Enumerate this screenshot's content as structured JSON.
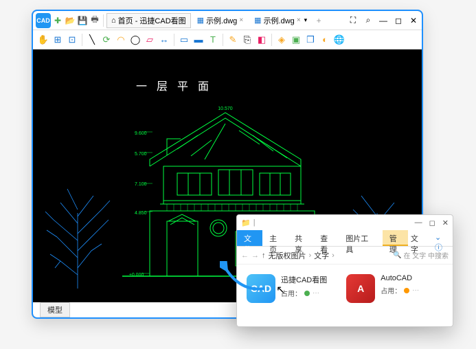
{
  "app": {
    "logo_text": "CAD"
  },
  "tabs": [
    {
      "icon": "⌂",
      "label": "首页 - 迅捷CAD看图"
    },
    {
      "icon": "▦",
      "label": "示例.dwg"
    },
    {
      "icon": "▦",
      "label": "示例.dwg"
    }
  ],
  "drawing": {
    "title": "一层平面",
    "dims": {
      "d1": "10.570",
      "d2": "9.600",
      "d3": "5.700",
      "d4": "7.100",
      "d5": "4.850",
      "d6": "±0.000"
    }
  },
  "status": {
    "tab": "模型"
  },
  "explorer": {
    "ribbon": {
      "file": "文件",
      "home": "主页",
      "share": "共享",
      "view": "查看",
      "pictools": "图片工具",
      "manage": "管理",
      "group": "文字"
    },
    "address": {
      "seg1": "无版权图片",
      "seg2": "文字"
    },
    "search": {
      "placeholder": "在 文字 中搜索"
    },
    "files": [
      {
        "name": "迅捷CAD看图",
        "status_label": "占用：",
        "icon_text": "CAD"
      },
      {
        "name": "AutoCAD",
        "status_label": "占用：",
        "icon_text": "A"
      }
    ]
  }
}
